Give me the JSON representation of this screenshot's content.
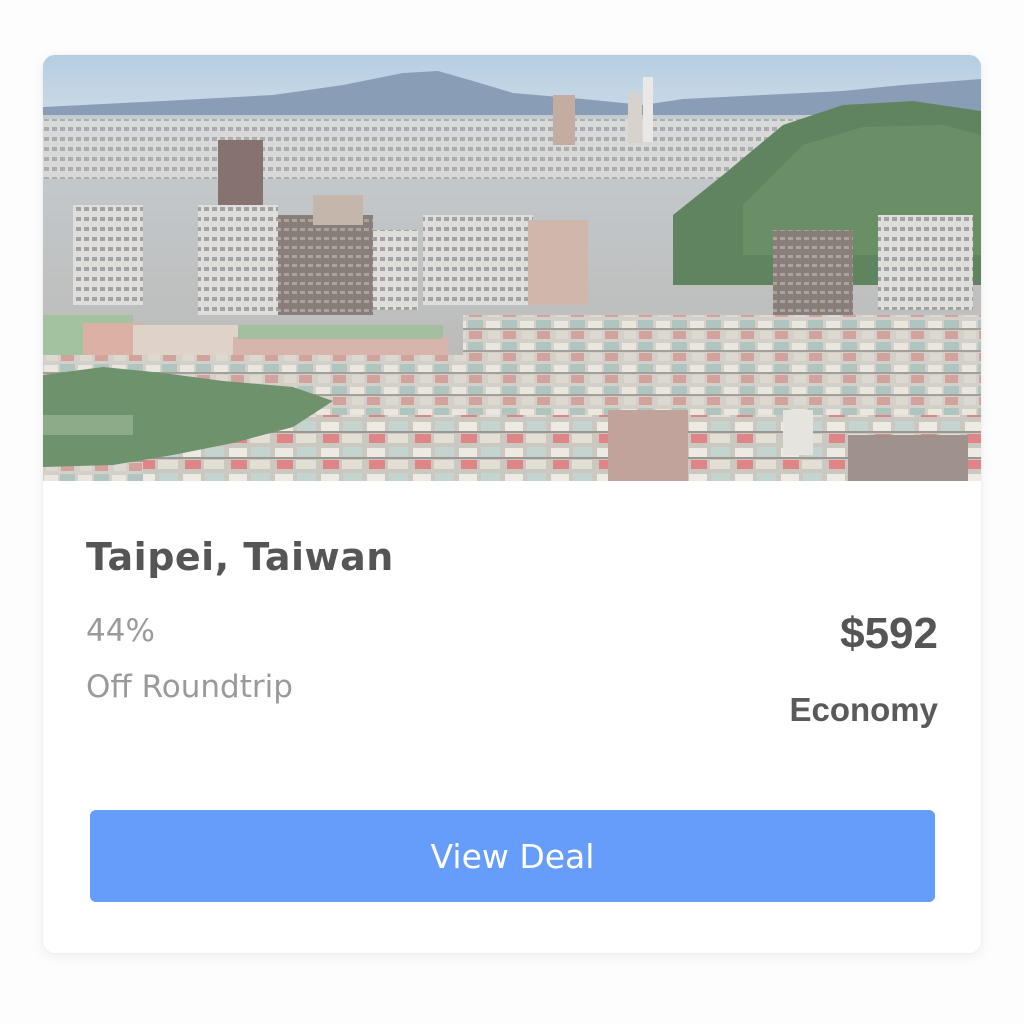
{
  "deal": {
    "destination": "Taipei, Taiwan",
    "discount_percent": "44%",
    "discount_label": "Off Roundtrip",
    "price": "$592",
    "cabin_class": "Economy",
    "cta_label": "View Deal"
  },
  "colors": {
    "button": "#669dfb",
    "title_text": "#555555",
    "muted_text": "#9a9a9a"
  },
  "hero": {
    "subject": "city skyline with mountains"
  }
}
